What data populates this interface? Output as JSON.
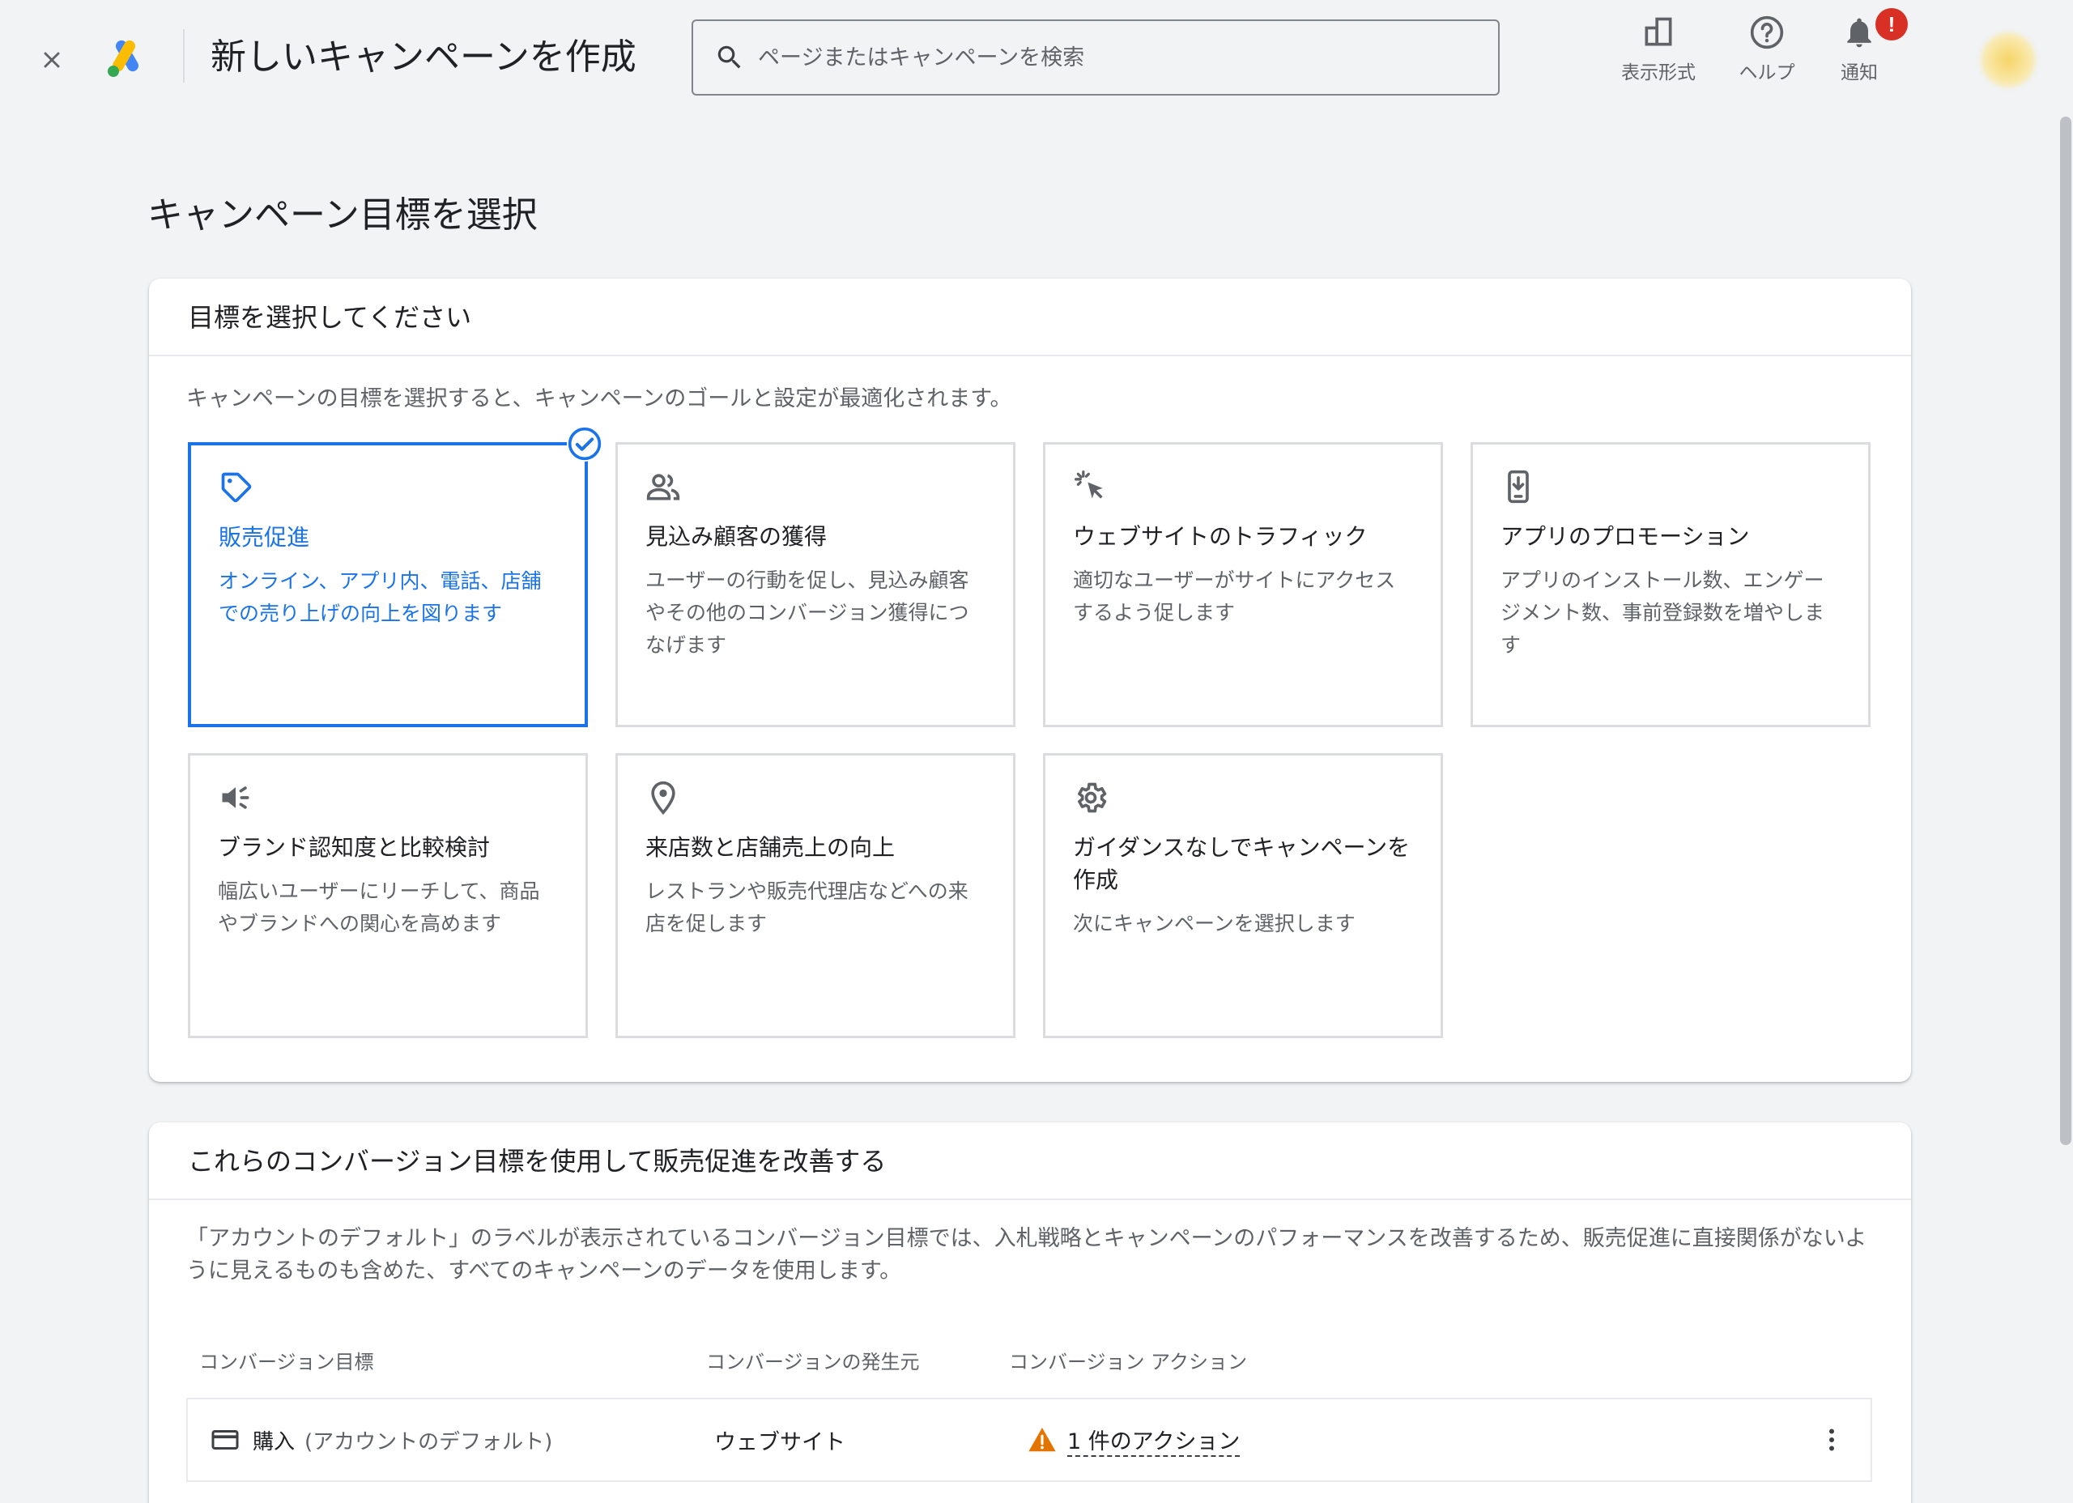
{
  "header": {
    "title": "新しいキャンペーンを作成",
    "search_placeholder": "ページまたはキャンペーンを検索",
    "tools": {
      "view_label": "表示形式",
      "help_label": "ヘルプ",
      "notify_label": "通知",
      "notify_badge": "!"
    }
  },
  "main": {
    "title": "キャンペーン目標を選択",
    "goals_card": {
      "heading": "目標を選択してください",
      "description": "キャンペーンの目標を選択すると、キャンペーンのゴールと設定が最適化されます。",
      "tiles": [
        {
          "icon": "tag-icon",
          "title": "販売促進",
          "desc": "オンライン、アプリ内、電話、店舗での売り上げの向上を図ります",
          "selected": true
        },
        {
          "icon": "people-icon",
          "title": "見込み顧客の獲得",
          "desc": "ユーザーの行動を促し、見込み顧客やその他のコンバージョン獲得につなげます",
          "selected": false
        },
        {
          "icon": "cursor-click-icon",
          "title": "ウェブサイトのトラフィック",
          "desc": "適切なユーザーがサイトにアクセスするよう促します",
          "selected": false
        },
        {
          "icon": "phone-download-icon",
          "title": "アプリのプロモーション",
          "desc": "アプリのインストール数、エンゲージメント数、事前登録数を増やします",
          "selected": false
        },
        {
          "icon": "megaphone-icon",
          "title": "ブランド認知度と比較検討",
          "desc": "幅広いユーザーにリーチして、商品やブランドへの関心を高めます",
          "selected": false
        },
        {
          "icon": "location-pin-icon",
          "title": "来店数と店舗売上の向上",
          "desc": "レストランや販売代理店などへの来店を促します",
          "selected": false
        },
        {
          "icon": "gear-icon",
          "title": "ガイダンスなしでキャンペーンを作成",
          "desc": "次にキャンペーンを選択します",
          "selected": false
        }
      ]
    },
    "conversion_card": {
      "heading": "これらのコンバージョン目標を使用して販売促進を改善する",
      "description": "「アカウントのデフォルト」のラベルが表示されているコンバージョン目標では、入札戦略とキャンペーンのパフォーマンスを改善するため、販売促進に直接関係がないように見えるものも含めた、すべてのキャンペーンのデータを使用します。",
      "columns": [
        "コンバージョン目標",
        "コンバージョンの発生元",
        "コンバージョン アクション"
      ],
      "rows": [
        {
          "goal": "購入",
          "goal_sub": "(アカウントのデフォルト)",
          "source": "ウェブサイト",
          "action": "1 件のアクション"
        }
      ]
    },
    "colors": {
      "accent": "#1a73e8",
      "warning": "#e37400",
      "badge": "#d93025"
    }
  }
}
